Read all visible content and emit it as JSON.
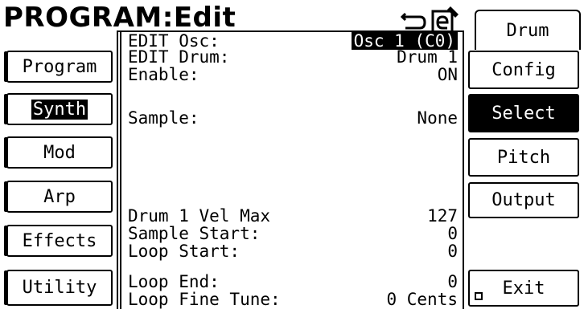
{
  "title": "PROGRAM:Edit",
  "top_icons": [
    "undo-icon",
    "edit-icon"
  ],
  "left_buttons": [
    {
      "label": "Program",
      "selected": false
    },
    {
      "label": "Synth",
      "selected": true
    },
    {
      "label": "Mod",
      "selected": false
    },
    {
      "label": "Arp",
      "selected": false
    },
    {
      "label": "Effects",
      "selected": false
    },
    {
      "label": "Utility",
      "selected": false
    }
  ],
  "right_buttons": [
    {
      "label": "Drum",
      "active": false
    },
    {
      "label": "Config",
      "active": false
    },
    {
      "label": "Select",
      "active": true
    },
    {
      "label": "Pitch",
      "active": false
    },
    {
      "label": "Output",
      "active": false
    },
    {
      "label": "Exit",
      "active": false
    }
  ],
  "params": [
    {
      "label": "EDIT Osc:",
      "value": "Osc 1 (C0)",
      "highlight": true
    },
    {
      "label": "EDIT Drum:",
      "value": "Drum 1",
      "highlight": false
    },
    {
      "label": "Enable:",
      "value": "ON",
      "highlight": false
    },
    {
      "label": "Sample:",
      "value": "None",
      "highlight": false
    },
    {
      "label": "Drum 1 Vel Max",
      "value": "127",
      "highlight": false
    },
    {
      "label": "Sample Start:",
      "value": "0",
      "highlight": false
    },
    {
      "label": "Loop Start:",
      "value": "0",
      "highlight": false
    },
    {
      "label": "Loop End:",
      "value": "0",
      "highlight": false
    },
    {
      "label": "Loop Fine Tune:",
      "value": "0 Cents",
      "highlight": false
    }
  ]
}
